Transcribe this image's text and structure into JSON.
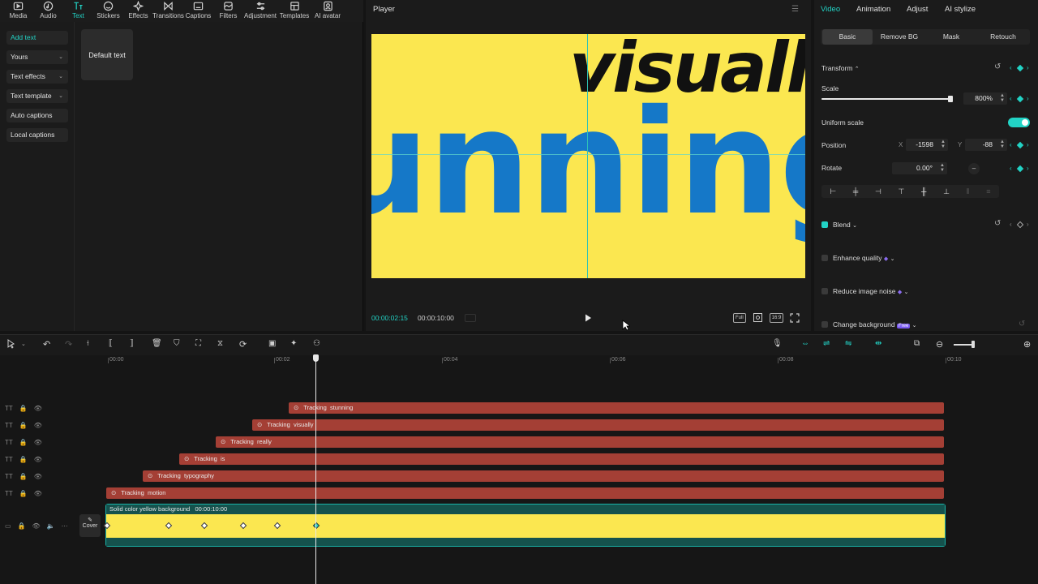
{
  "toolbar": {
    "items": [
      {
        "label": "Media",
        "icon": "media-icon"
      },
      {
        "label": "Audio",
        "icon": "audio-icon"
      },
      {
        "label": "Text",
        "icon": "text-icon"
      },
      {
        "label": "Stickers",
        "icon": "stickers-icon"
      },
      {
        "label": "Effects",
        "icon": "effects-icon"
      },
      {
        "label": "Transitions",
        "icon": "transitions-icon"
      },
      {
        "label": "Captions",
        "icon": "captions-icon"
      },
      {
        "label": "Filters",
        "icon": "filters-icon"
      },
      {
        "label": "Adjustment",
        "icon": "adjustment-icon"
      },
      {
        "label": "Templates",
        "icon": "templates-icon"
      },
      {
        "label": "AI avatar",
        "icon": "ai-avatar-icon"
      }
    ],
    "active": "Text",
    "accent": "#22d3c5"
  },
  "left_nav": {
    "items": [
      "Add text",
      "Yours",
      "Text effects",
      "Text template",
      "Auto captions",
      "Local captions"
    ],
    "active": "Add text",
    "default_text_card": "Default text"
  },
  "player": {
    "title": "Player",
    "words": {
      "top": "visually",
      "main": "unning"
    },
    "current_time": "00:00:02:15",
    "total_time": "00:00:10:00",
    "controls": {
      "full": "Full",
      "ratio": "16:9"
    },
    "canvas_color": "#fbe750",
    "text_color_top": "#111111",
    "text_color_main": "#1578c8"
  },
  "right_panel": {
    "tabs": [
      "Video",
      "Animation",
      "Adjust",
      "AI stylize"
    ],
    "active_tab": "Video",
    "subtabs": [
      "Basic",
      "Remove BG",
      "Mask",
      "Retouch"
    ],
    "active_subtab": "Basic",
    "transform_label": "Transform",
    "scale_label": "Scale",
    "scale_value": "800%",
    "scale_fraction": 0.98,
    "uniform_scale_label": "Uniform scale",
    "uniform_scale_on": true,
    "position_label": "Position",
    "pos_x_label": "X",
    "pos_x": "-1598",
    "pos_y_label": "Y",
    "pos_y": "-88",
    "rotate_label": "Rotate",
    "rotate_value": "0.00°",
    "blend_label": "Blend",
    "blend_on": true,
    "enhance_label": "Enhance quality",
    "reduce_noise_label": "Reduce image noise",
    "change_bg_label": "Change background",
    "free_badge": "Free"
  },
  "timeline": {
    "ruler": [
      "00:00",
      "00:02",
      "00:04",
      "00:06",
      "00:08",
      "00:10"
    ],
    "text_tracks": [
      {
        "tag": "Tracking",
        "name": "stunning"
      },
      {
        "tag": "Tracking",
        "name": "visually"
      },
      {
        "tag": "Tracking",
        "name": "really"
      },
      {
        "tag": "Tracking",
        "name": "is"
      },
      {
        "tag": "Tracking",
        "name": "typography"
      },
      {
        "tag": "Tracking",
        "name": "motion"
      }
    ],
    "video_clip": {
      "name": "Solid color yellow background",
      "duration": "00:00:10:00"
    },
    "cover_label": "Cover"
  }
}
